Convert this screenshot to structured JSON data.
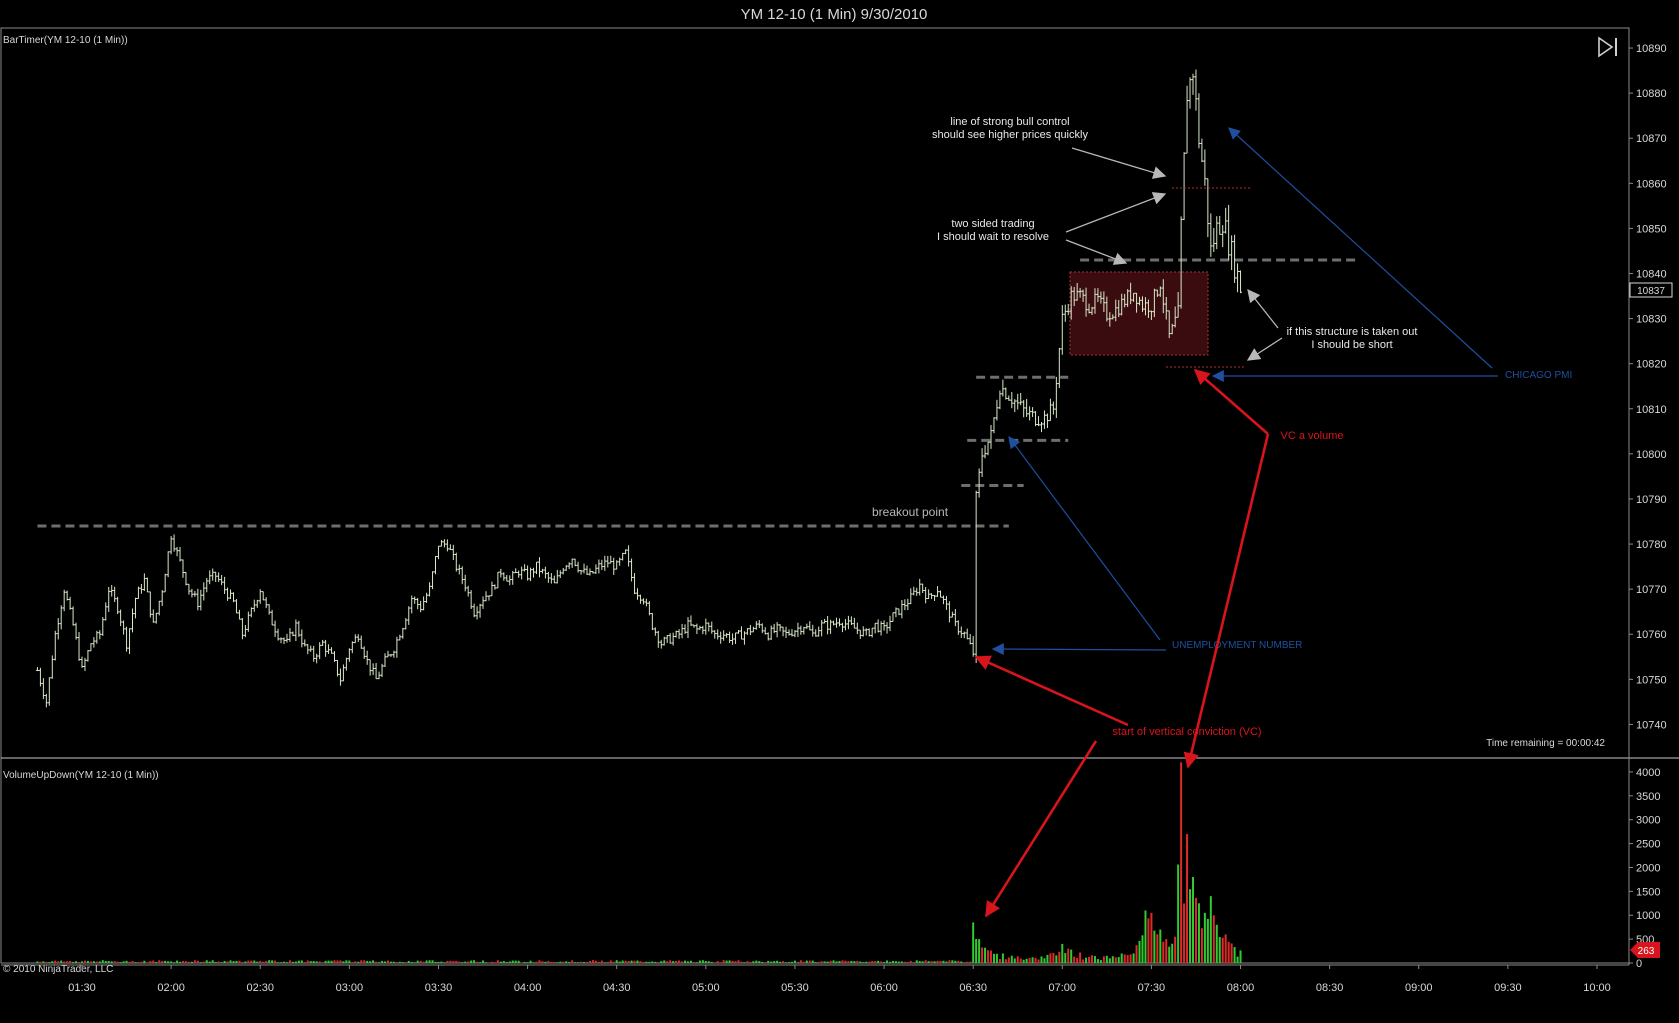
{
  "window": {
    "title": "YM 12-10 (1 Min)  9/30/2010"
  },
  "chart_data": [
    {
      "type": "bar",
      "subtype": "ohlc",
      "panel": "price",
      "indicator_label": "BarTimer(YM 12-10 (1 Min))",
      "instrument": "YM 12-10 (1 Min)",
      "ylim": [
        10733,
        10894
      ],
      "y_ticks": [
        10740,
        10750,
        10760,
        10770,
        10780,
        10790,
        10800,
        10810,
        10820,
        10830,
        10840,
        10850,
        10860,
        10870,
        10880,
        10890
      ],
      "last_price_label": "10837",
      "time_remaining": "Time remaining = 00:00:42",
      "series": [
        {
          "name": "price",
          "points": [
            [
              "01:15",
              10752
            ],
            [
              "01:18",
              10745
            ],
            [
              "01:21",
              10760
            ],
            [
              "01:24",
              10770
            ],
            [
              "01:27",
              10762
            ],
            [
              "01:30",
              10752
            ],
            [
              "01:33",
              10758
            ],
            [
              "01:36",
              10760
            ],
            [
              "01:39",
              10770
            ],
            [
              "01:42",
              10766
            ],
            [
              "01:45",
              10758
            ],
            [
              "01:48",
              10768
            ],
            [
              "01:51",
              10772
            ],
            [
              "01:54",
              10762
            ],
            [
              "01:57",
              10770
            ],
            [
              "02:00",
              10782
            ],
            [
              "02:03",
              10776
            ],
            [
              "02:06",
              10770
            ],
            [
              "02:09",
              10767
            ],
            [
              "02:12",
              10772
            ],
            [
              "02:15",
              10773
            ],
            [
              "02:18",
              10770
            ],
            [
              "02:21",
              10767
            ],
            [
              "02:24",
              10760
            ],
            [
              "02:27",
              10765
            ],
            [
              "02:30",
              10770
            ],
            [
              "02:33",
              10764
            ],
            [
              "02:36",
              10760
            ],
            [
              "02:39",
              10758
            ],
            [
              "02:42",
              10762
            ],
            [
              "02:45",
              10757
            ],
            [
              "02:48",
              10755
            ],
            [
              "02:51",
              10758
            ],
            [
              "02:54",
              10755
            ],
            [
              "02:57",
              10750
            ],
            [
              "03:00",
              10757
            ],
            [
              "03:03",
              10760
            ],
            [
              "03:06",
              10754
            ],
            [
              "03:09",
              10750
            ],
            [
              "03:12",
              10754
            ],
            [
              "03:15",
              10757
            ],
            [
              "03:18",
              10762
            ],
            [
              "03:21",
              10768
            ],
            [
              "03:24",
              10766
            ],
            [
              "03:27",
              10770
            ],
            [
              "03:30",
              10780
            ],
            [
              "03:33",
              10780
            ],
            [
              "03:36",
              10775
            ],
            [
              "03:39",
              10771
            ],
            [
              "03:42",
              10765
            ],
            [
              "03:45",
              10768
            ],
            [
              "03:48",
              10770
            ],
            [
              "03:51",
              10774
            ],
            [
              "03:54",
              10772
            ],
            [
              "03:57",
              10774
            ],
            [
              "04:00",
              10773
            ],
            [
              "04:03",
              10775
            ],
            [
              "04:06",
              10773
            ],
            [
              "04:09",
              10771
            ],
            [
              "04:12",
              10775
            ],
            [
              "04:15",
              10777
            ],
            [
              "04:18",
              10774
            ],
            [
              "04:21",
              10773
            ],
            [
              "04:24",
              10775
            ],
            [
              "04:27",
              10776
            ],
            [
              "04:30",
              10775
            ],
            [
              "04:33",
              10778
            ],
            [
              "04:36",
              10770
            ],
            [
              "04:39",
              10768
            ],
            [
              "04:42",
              10762
            ],
            [
              "04:45",
              10758
            ],
            [
              "04:48",
              10759
            ],
            [
              "04:51",
              10760
            ],
            [
              "04:54",
              10762
            ],
            [
              "04:57",
              10761
            ],
            [
              "05:00",
              10762
            ],
            [
              "05:03",
              10760
            ],
            [
              "05:06",
              10760
            ],
            [
              "05:09",
              10759
            ],
            [
              "05:12",
              10760
            ],
            [
              "05:15",
              10761
            ],
            [
              "05:18",
              10762
            ],
            [
              "05:21",
              10760
            ],
            [
              "05:24",
              10761
            ],
            [
              "05:27",
              10760
            ],
            [
              "05:30",
              10761
            ],
            [
              "05:33",
              10762
            ],
            [
              "05:36",
              10760
            ],
            [
              "05:39",
              10762
            ],
            [
              "05:42",
              10762
            ],
            [
              "05:45",
              10763
            ],
            [
              "05:48",
              10762
            ],
            [
              "05:51",
              10761
            ],
            [
              "05:54",
              10760
            ],
            [
              "05:57",
              10762
            ],
            [
              "06:00",
              10761
            ],
            [
              "06:03",
              10764
            ],
            [
              "06:06",
              10766
            ],
            [
              "06:09",
              10768
            ],
            [
              "06:12",
              10771
            ],
            [
              "06:15",
              10768
            ],
            [
              "06:18",
              10770
            ],
            [
              "06:21",
              10766
            ],
            [
              "06:24",
              10762
            ],
            [
              "06:27",
              10760
            ],
            [
              "06:30",
              10756
            ],
            [
              "06:31",
              10790
            ],
            [
              "06:33",
              10800
            ],
            [
              "06:36",
              10804
            ],
            [
              "06:39",
              10815
            ],
            [
              "06:42",
              10813
            ],
            [
              "06:45",
              10811
            ],
            [
              "06:48",
              10809
            ],
            [
              "06:51",
              10808
            ],
            [
              "06:54",
              10808
            ],
            [
              "06:57",
              10810
            ],
            [
              "07:00",
              10830
            ],
            [
              "07:03",
              10835
            ],
            [
              "07:06",
              10835
            ],
            [
              "07:09",
              10833
            ],
            [
              "07:12",
              10834
            ],
            [
              "07:15",
              10831
            ],
            [
              "07:18",
              10832
            ],
            [
              "07:21",
              10834
            ],
            [
              "07:24",
              10836
            ],
            [
              "07:27",
              10833
            ],
            [
              "07:30",
              10833
            ],
            [
              "07:33",
              10838
            ],
            [
              "07:36",
              10826
            ],
            [
              "07:39",
              10830
            ],
            [
              "07:40",
              10850
            ],
            [
              "07:42",
              10880
            ],
            [
              "07:44",
              10885
            ],
            [
              "07:46",
              10870
            ],
            [
              "07:48",
              10860
            ],
            [
              "07:50",
              10845
            ],
            [
              "07:52",
              10850
            ],
            [
              "07:54",
              10852
            ],
            [
              "07:56",
              10847
            ],
            [
              "07:58",
              10842
            ],
            [
              "08:00",
              10837
            ]
          ]
        }
      ],
      "annotations": [
        {
          "kind": "level",
          "text": "breakout point",
          "value": 10784
        },
        {
          "kind": "note",
          "text": "line of strong bull control should see higher prices quickly",
          "lines": [
            "line of strong bull control",
            "should see higher prices quickly"
          ]
        },
        {
          "kind": "note",
          "text": "two sided trading I should wait to resolve",
          "lines": [
            "two sided trading",
            "I should wait to resolve"
          ]
        },
        {
          "kind": "note",
          "text": "if this structure is taken out I should be short",
          "lines": [
            "if this structure is taken out",
            "I should be short"
          ]
        },
        {
          "kind": "event",
          "text": "CHICAGO PMI"
        },
        {
          "kind": "event",
          "text": "UNEMPLOYMENT NUMBER"
        },
        {
          "kind": "note",
          "text": "VC a volume"
        },
        {
          "kind": "note",
          "text": "start of vertical conviction (VC)"
        }
      ],
      "levels": [
        10784,
        10793,
        10803,
        10817,
        10843
      ]
    },
    {
      "type": "bar",
      "panel": "volume",
      "indicator_label": "VolumeUpDown(YM 12-10 (1 Min))",
      "ylim": [
        0,
        4250
      ],
      "y_ticks": [
        0,
        500,
        1000,
        1500,
        2000,
        2500,
        3000,
        3500,
        4000
      ],
      "last_volume_label": "263",
      "series": [
        {
          "name": "volume",
          "points": [
            [
              "01:15",
              60
            ],
            [
              "02:00",
              60
            ],
            [
              "03:00",
              50
            ],
            [
              "04:00",
              40
            ],
            [
              "05:00",
              30
            ],
            [
              "06:00",
              40
            ],
            [
              "06:30",
              850
            ],
            [
              "06:32",
              500
            ],
            [
              "06:34",
              320
            ],
            [
              "06:36",
              260
            ],
            [
              "06:40",
              200
            ],
            [
              "06:45",
              140
            ],
            [
              "06:50",
              120
            ],
            [
              "06:55",
              170
            ],
            [
              "07:00",
              400
            ],
            [
              "07:03",
              280
            ],
            [
              "07:06",
              220
            ],
            [
              "07:10",
              160
            ],
            [
              "07:15",
              150
            ],
            [
              "07:20",
              200
            ],
            [
              "07:24",
              200
            ],
            [
              "07:28",
              1100
            ],
            [
              "07:30",
              1050
            ],
            [
              "07:33",
              700
            ],
            [
              "07:35",
              500
            ],
            [
              "07:38",
              550
            ],
            [
              "07:40",
              4200
            ],
            [
              "07:42",
              2700
            ],
            [
              "07:44",
              1800
            ],
            [
              "07:46",
              1250
            ],
            [
              "07:48",
              1050
            ],
            [
              "07:50",
              1400
            ],
            [
              "07:52",
              800
            ],
            [
              "07:55",
              600
            ],
            [
              "08:00",
              263
            ]
          ]
        }
      ]
    }
  ],
  "x_axis": {
    "ticks": [
      "01:30",
      "02:00",
      "02:30",
      "03:00",
      "03:30",
      "04:00",
      "04:30",
      "05:00",
      "05:30",
      "06:00",
      "06:30",
      "07:00",
      "07:30",
      "08:00",
      "08:30",
      "09:00",
      "09:30",
      "10:00"
    ]
  },
  "footer": {
    "copyright": "© 2010 NinjaTrader, LLC"
  },
  "colors": {
    "background": "#000000",
    "price_bar": "#d8e8c8",
    "up_volume": "#2fcc2f",
    "down_volume": "#e02a2a",
    "level_line": "#6e6e6e",
    "note_arrow": "#b8b8b8",
    "event_arrow": "#1f4f9e",
    "vc_arrow": "#d8141c",
    "zone_fill": "#3a0c10",
    "zone_border": "#b03030"
  }
}
